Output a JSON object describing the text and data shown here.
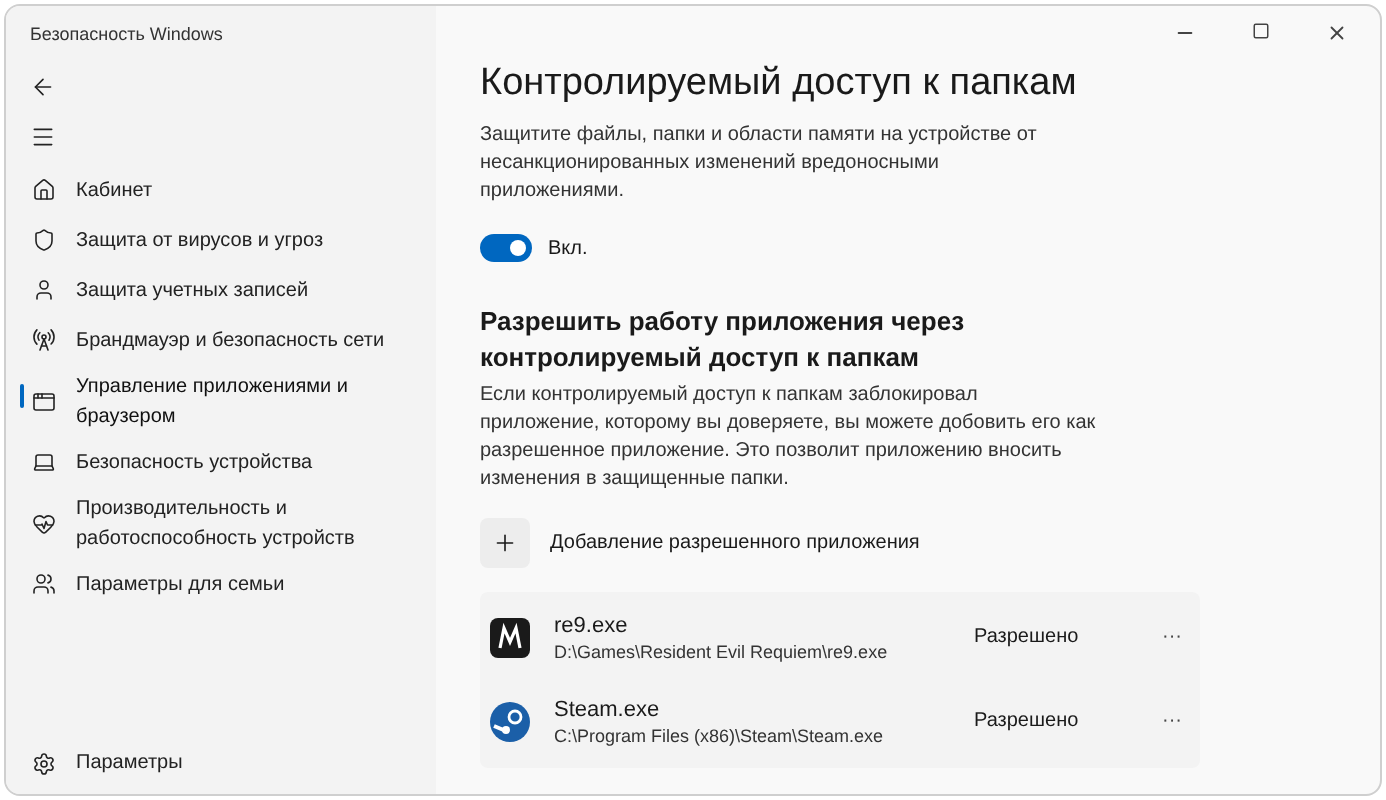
{
  "window": {
    "title": "Безопасность Windows"
  },
  "sidebar": {
    "items": [
      {
        "label": "Кабинет",
        "selected": false
      },
      {
        "label": "Защита от вирусов и угроз",
        "selected": false
      },
      {
        "label": "Защита учетных записей",
        "selected": false
      },
      {
        "label": "Брандмауэр и безопасность сети",
        "selected": false
      },
      {
        "label": "Управление приложениями и браузером",
        "selected": true
      },
      {
        "label": "Безопасность устройства",
        "selected": false
      },
      {
        "label": "Производительность и работоспособность устройств",
        "selected": false
      },
      {
        "label": "Параметры для семьи",
        "selected": false
      }
    ],
    "settings": "Параметры"
  },
  "page": {
    "title": "Контролируемый доступ к папкам",
    "description": "Защитите файлы, папки и области памяти на устройстве от несанкционированных изменений вредоносными приложениями.",
    "toggle": {
      "on": true,
      "label": "Вкл."
    },
    "section": {
      "title": "Разрешить работу приложения через контролируемый доступ к папкам",
      "description": "Если контролируемый доступ к папкам заблокировал приложение, которому вы доверяете, вы можете добовить его как разрешенное приложение. Это позволит приложению вносить изменения в защищенные папки.",
      "add_button": "Добавление разрешенного приложения"
    },
    "apps": [
      {
        "name": "re9.exe",
        "path": "D:\\Games\\Resident Evil Requiem\\re9.exe",
        "status": "Разрешено",
        "more": "···"
      },
      {
        "name": "Steam.exe",
        "path": "C:\\Program Files (x86)\\Steam\\Steam.exe",
        "status": "Разрешено",
        "more": "···"
      }
    ]
  }
}
